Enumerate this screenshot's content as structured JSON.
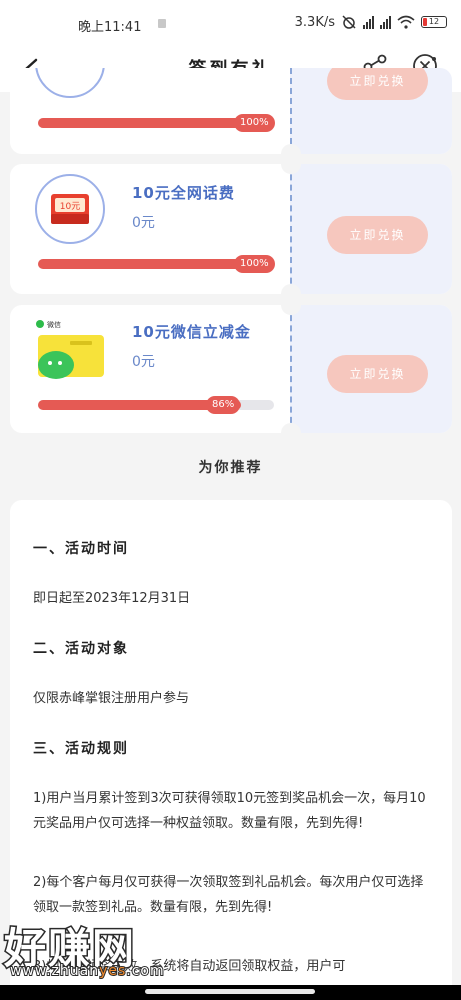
{
  "status_bar": {
    "time": "晚上11:41",
    "net_speed": "3.3K/s",
    "battery": "12"
  },
  "nav": {
    "title": "签到有礼"
  },
  "prizes": [
    {
      "name": "",
      "value": "",
      "progress_label": "100%",
      "progress_fraction": 1.0,
      "button": "立即兑换"
    },
    {
      "name": "10元全网话费",
      "value": "0元",
      "progress_label": "100%",
      "progress_fraction": 1.0,
      "button": "立即兑换",
      "thumb_text": "10元"
    },
    {
      "name": "10元微信立减金",
      "value": "0元",
      "progress_label": "86%",
      "progress_fraction": 0.86,
      "button": "立即兑换",
      "thumb_text": "微信"
    }
  ],
  "recommend_title": "为你推荐",
  "rules": {
    "h1": "一、活动时间",
    "p1": "即日起至2023年12月31日",
    "h2": "二、活动对象",
    "p2": "仅限赤峰掌银注册用户参与",
    "h3": "三、活动规则",
    "p3": "1)用户当月累计签到3次可获得领取10元签到奖品机会一次，每月10元奖品用户仅可选择一种权益领取。数量有限，先到先得!",
    "p4": "2)每个客户每月仅可获得一次领取签到礼品机会。每次用户仅可选择领取一款签到礼品。数量有限，先到先得!",
    "p5": "3)如参与领奖失败，系统将自动返回领取权益，用户可"
  },
  "watermark": {
    "text": "好赚网",
    "url_prefix": "www.zhuan",
    "url_accent": "yes",
    "url_suffix": ".com"
  },
  "colors": {
    "accent_red": "#e55a54",
    "redeem_bg": "#f6c7be",
    "title_blue": "#4a6ec2"
  }
}
